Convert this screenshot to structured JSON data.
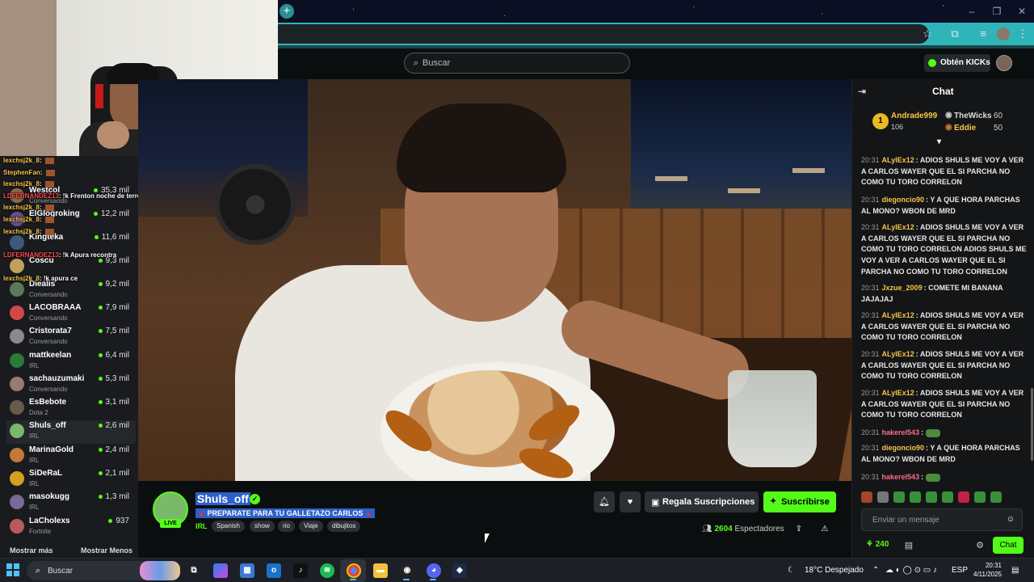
{
  "browser": {
    "new_tab": "+",
    "window_controls": [
      "–",
      "❐",
      "✕"
    ]
  },
  "header": {
    "search_placeholder": "Buscar",
    "kicks_label": "Obtén KICKs"
  },
  "overlay_chat": [
    {
      "user": "lexchsj2k_8",
      "msg": ""
    },
    {
      "user": "StephenFan",
      "msg": ""
    },
    {
      "user": "lexchsj2k_8",
      "msg": ""
    },
    {
      "user": "LDFERNANDEZ13",
      "msg": "!k Frenton noche de terror"
    },
    {
      "user": "lexchsj2k_8",
      "msg": ""
    },
    {
      "user": "lexchsj2k_8",
      "msg": ""
    },
    {
      "user": "lexchsj2k_8",
      "msg": ""
    },
    {
      "user": "LDFERNANDEZ13",
      "msg": "!k Apura recontra"
    },
    {
      "user": "lexchsj2k_8",
      "msg": "!k apura ce"
    }
  ],
  "sidebar": {
    "channels": [
      {
        "name": "Westcol",
        "sub": "Conversando",
        "views": "35,3 mil",
        "color": "#8c6a4a"
      },
      {
        "name": "ElGlogroking",
        "sub": "",
        "views": "12,2 mil",
        "color": "#6a4c8c"
      },
      {
        "name": "Kingteka",
        "sub": "",
        "views": "11,6 mil",
        "color": "#3c5a7a"
      },
      {
        "name": "Coscu",
        "sub": "",
        "views": "9,3 mil",
        "color": "#c0a060"
      },
      {
        "name": "Diealis",
        "sub": "Conversando",
        "views": "9,2 mil",
        "color": "#5a7a5a"
      },
      {
        "name": "LACOBRAAA",
        "sub": "Conversando",
        "views": "7,9 mil",
        "color": "#d04848"
      },
      {
        "name": "Cristorata7",
        "sub": "Conversando",
        "views": "7,5 mil",
        "color": "#8a8a8a"
      },
      {
        "name": "mattkeelan",
        "sub": "IRL",
        "views": "6,4 mil",
        "color": "#2a7a3a"
      },
      {
        "name": "sachauzumaki",
        "sub": "Conversando",
        "views": "5,3 mil",
        "color": "#9a7a6a"
      },
      {
        "name": "EsBebote",
        "sub": "Dota 2",
        "views": "3,1 mil",
        "color": "#6a5a4a"
      },
      {
        "name": "Shuls_off",
        "sub": "IRL",
        "views": "2,6 mil",
        "color": "#7ab86a"
      },
      {
        "name": "MarinaGold",
        "sub": "IRL",
        "views": "2,4 mil",
        "color": "#c4783a"
      },
      {
        "name": "SiDeRaL",
        "sub": "IRL",
        "views": "2,1 mil",
        "color": "#d4a020"
      },
      {
        "name": "masokugg",
        "sub": "IRL",
        "views": "1,3 mil",
        "color": "#7a6a9a"
      },
      {
        "name": "LaCholexs",
        "sub": "Fortnite",
        "views": "937",
        "color": "#b85a5a"
      }
    ],
    "show_more": "Mostrar más",
    "show_less": "Mostrar Menos"
  },
  "stream": {
    "streamer": "Shuls_off",
    "live": "LIVE",
    "title": "PREPARATE PARA TU GALLETAZO CARLOS",
    "category": "IRL",
    "tags": [
      "Spanish",
      "show",
      "rio",
      "Viaje",
      "dibujitos"
    ],
    "gift_label": "Regala Suscripciones",
    "subscribe_label": "Suscribirse",
    "viewers_count": "2604",
    "viewers_label": "Espectadores"
  },
  "chat": {
    "title": "Chat",
    "leaderboard": {
      "first": {
        "rank": "1",
        "name": "Andrade999",
        "points": "106"
      },
      "second": {
        "name": "TheWicks",
        "points": "60"
      },
      "third": {
        "name": "Eddie",
        "points": "50"
      }
    },
    "messages": [
      {
        "time": "20:31",
        "user": "ALyIEx12",
        "color": "#f7c548",
        "text": "ADIOS SHULS ME VOY A VER A CARLOS WAYER QUE EL SI PARCHA NO COMO TU TORO CORRELON"
      },
      {
        "time": "20:31",
        "user": "diegoncio90",
        "color": "#f7c548",
        "text": "Y A QUE HORA PARCHAS AL MONO? WBON DE MRD"
      },
      {
        "time": "20:31",
        "user": "ALyIEx12",
        "color": "#f7c548",
        "text": "ADIOS SHULS ME VOY A VER A CARLOS WAYER QUE EL SI PARCHA NO COMO TU TORO CORRELON ADIOS SHULS ME VOY A VER A CARLOS WAYER QUE EL SI PARCHA NO COMO TU TORO CORRELON"
      },
      {
        "time": "20:31",
        "user": "Jxzue_2009",
        "color": "#f7c548",
        "text": "COMETE MI BANANA JAJAJAJ"
      },
      {
        "time": "20:31",
        "user": "ALyIEx12",
        "color": "#f7c548",
        "text": "ADIOS SHULS ME VOY A VER A CARLOS WAYER QUE EL SI PARCHA NO COMO TU TORO CORRELON"
      },
      {
        "time": "20:31",
        "user": "ALyIEx12",
        "color": "#f7c548",
        "text": "ADIOS SHULS ME VOY A VER A CARLOS WAYER QUE EL SI PARCHA NO COMO TU TORO CORRELON"
      },
      {
        "time": "20:31",
        "user": "ALyIEx12",
        "color": "#f7c548",
        "text": "ADIOS SHULS ME VOY A VER A CARLOS WAYER QUE EL SI PARCHA NO COMO TU TORO CORRELON"
      },
      {
        "time": "20:31",
        "user": "hakerel543",
        "color": "#ff6b8a",
        "text": ""
      },
      {
        "time": "20:31",
        "user": "diegoncio90",
        "color": "#f7c548",
        "text": "Y A QUE HORA PARCHAS AL MONO? WBON DE MRD"
      },
      {
        "time": "20:31",
        "user": "hakerel543",
        "color": "#ff6b8a",
        "text": ""
      }
    ],
    "input_placeholder": "Enviar un mensaje",
    "points": "240",
    "send_label": "Chat"
  },
  "taskbar": {
    "search_label": "Buscar",
    "weather": "18°C  Despejado",
    "lang": "ESP",
    "time": "20:31",
    "date": "4/11/2025"
  },
  "colors": {
    "kick_green": "#53fc18",
    "chat_name": "#f7c548",
    "taskbar": "#1c1f26"
  }
}
